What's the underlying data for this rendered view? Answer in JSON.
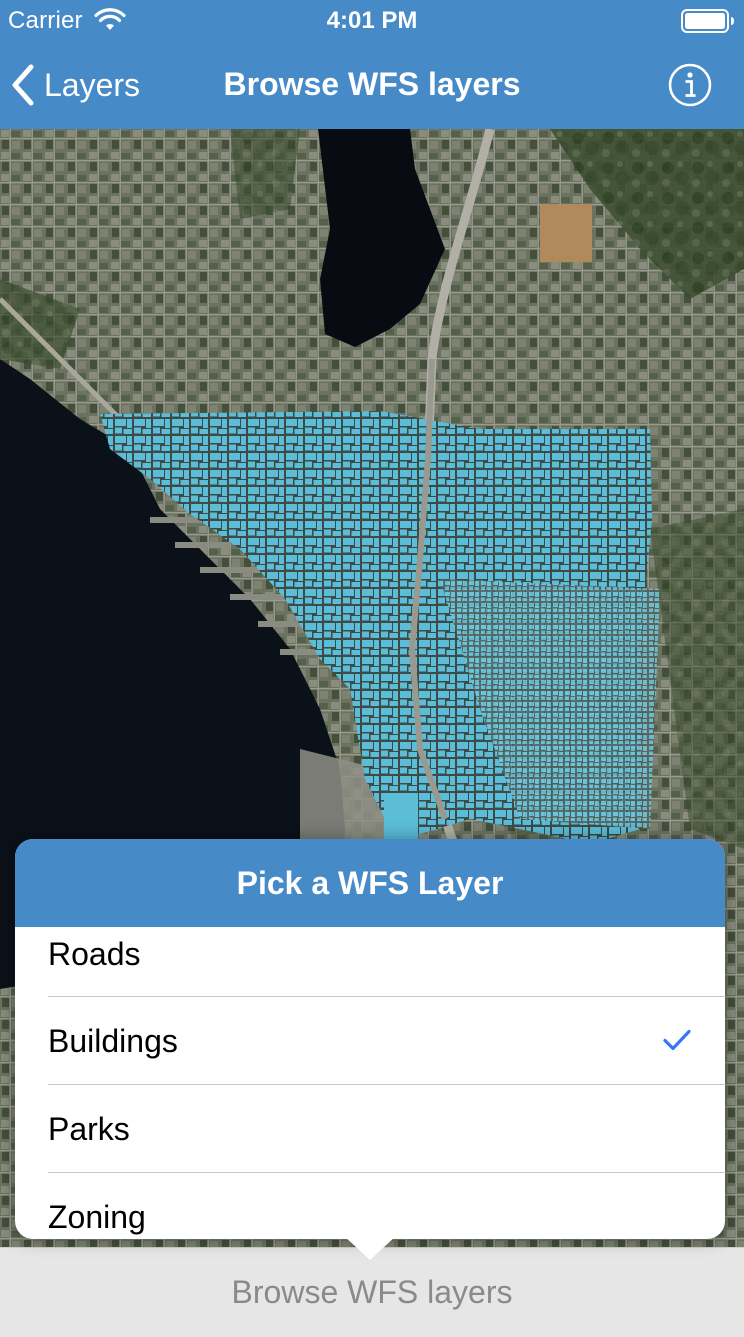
{
  "status_bar": {
    "carrier": "Carrier",
    "time": "4:01 PM"
  },
  "nav": {
    "back_label": "Layers",
    "title": "Browse WFS layers",
    "back_icon": "chevron-left-icon",
    "info_icon": "info-circle-icon"
  },
  "popover": {
    "title": "Pick a WFS Layer",
    "layers": [
      {
        "label": "Roads",
        "selected": false
      },
      {
        "label": "Buildings",
        "selected": true
      },
      {
        "label": "Parks",
        "selected": false
      },
      {
        "label": "Zoning",
        "selected": false
      }
    ]
  },
  "toolbar": {
    "button_label": "Browse WFS layers"
  },
  "colors": {
    "nav_blue": "#468ac8",
    "building_fill": "#5bbdd8",
    "check_blue": "#3478f6",
    "toolbar_text": "#8a8a8a"
  }
}
